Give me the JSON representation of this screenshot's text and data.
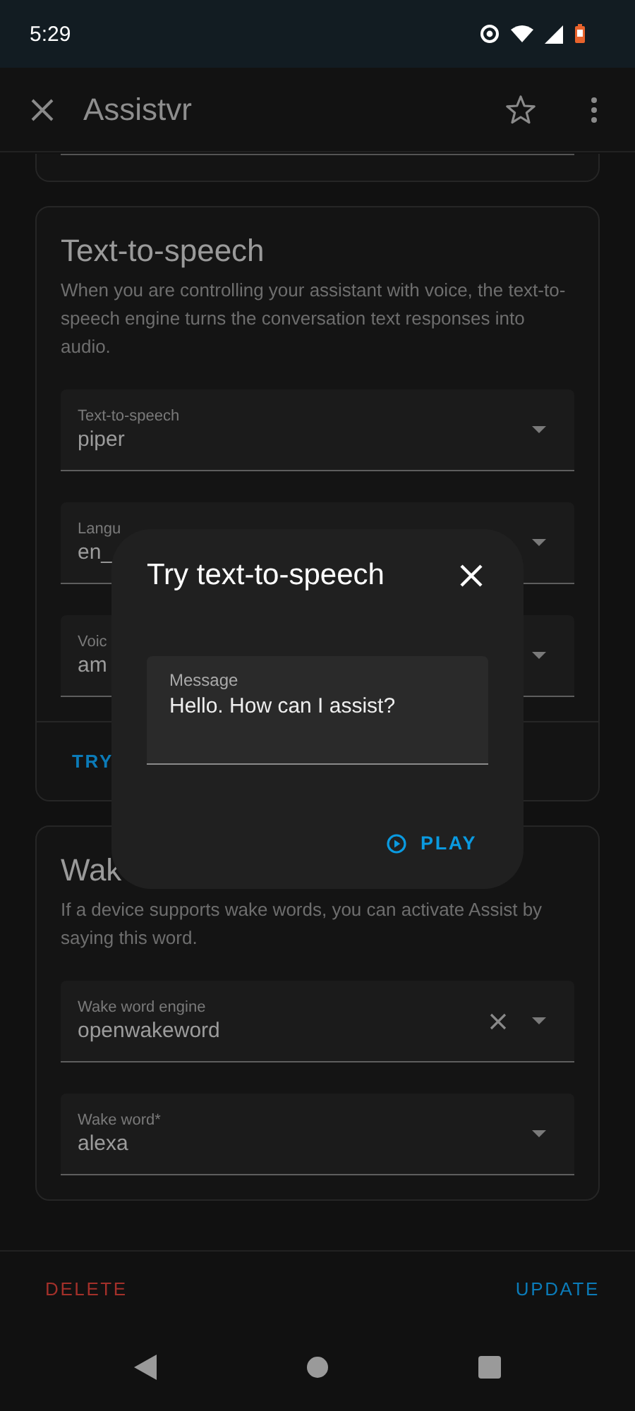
{
  "status_bar": {
    "time": "5:29"
  },
  "app_bar": {
    "title": "Assistvr"
  },
  "tts_section": {
    "title": "Text-to-speech",
    "description": "When you are controlling your assistant with voice, the text-to-speech engine turns the conversation text responses into audio.",
    "fields": [
      {
        "label": "Text-to-speech",
        "value": "piper",
        "clearable": false
      },
      {
        "label": "Langu",
        "value": "en_"
      },
      {
        "label": "Voic",
        "value": "am"
      }
    ],
    "action": "TRY"
  },
  "wake_section": {
    "title": "Wak",
    "description": "If a device supports wake words, you can activate Assist by saying this word.",
    "fields": [
      {
        "label": "Wake word engine",
        "value": "openwakeword",
        "clearable": true
      },
      {
        "label": "Wake word*",
        "value": "alexa",
        "clearable": false
      }
    ]
  },
  "footer": {
    "delete": "DELETE",
    "update": "UPDATE"
  },
  "dialog": {
    "title": "Try text-to-speech",
    "message": {
      "label": "Message",
      "value": "Hello. How can I assist?"
    },
    "play": "PLAY"
  }
}
